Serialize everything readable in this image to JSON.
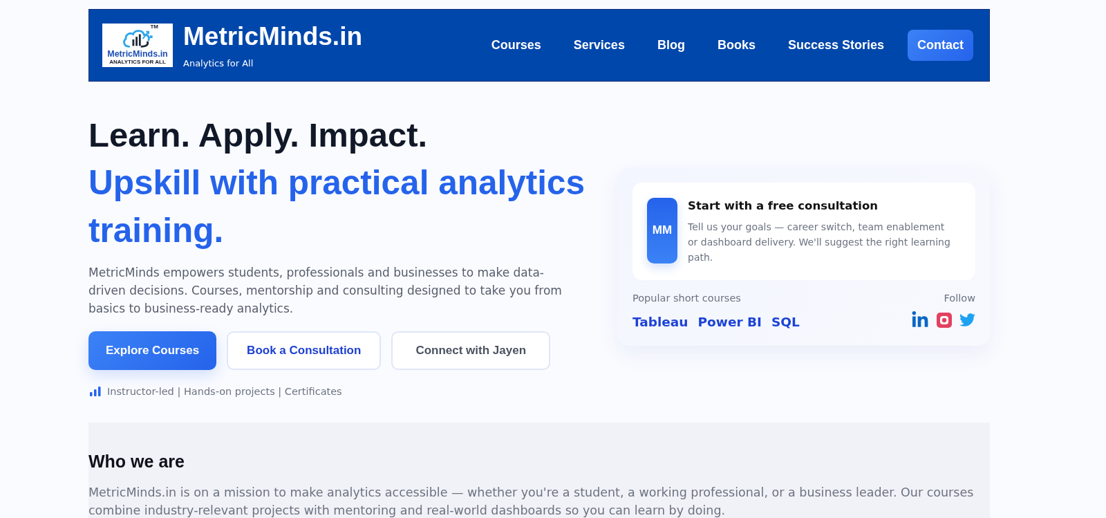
{
  "header": {
    "logo": {
      "mark": "TM",
      "wordmark": "MetricMinds.in",
      "tagline": "ANALYTICS FOR ALL"
    },
    "brand": "MetricMinds.in",
    "slogan": "Analytics for All"
  },
  "nav": [
    {
      "label": "Courses",
      "kind": "link"
    },
    {
      "label": "Services",
      "kind": "link"
    },
    {
      "label": "Blog",
      "kind": "link"
    },
    {
      "label": "Books",
      "kind": "link"
    },
    {
      "label": "Success Stories",
      "kind": "link"
    },
    {
      "label": "Contact",
      "kind": "button"
    }
  ],
  "hero": {
    "title": "Learn. Apply. Impact.",
    "subtitle": "Upskill with practical analytics training.",
    "intro": "MetricMinds empowers students, professionals and businesses to make data-driven decisions. Courses, mentorship and consulting designed to take you from basics to business-ready analytics.",
    "buttons": [
      {
        "label": "Explore Courses",
        "kind": "primary"
      },
      {
        "label": "Book a Consultation",
        "kind": "outline"
      },
      {
        "label": "Connect with Jayen",
        "kind": "ghost"
      }
    ],
    "features": "Instructor-led | Hands-on projects | Certificates"
  },
  "consult_card": {
    "badge": "MM",
    "title": "Start with a free consultation",
    "text": "Tell us your goals — career switch, team enablement or dashboard delivery. We'll suggest the right learning path.",
    "courses_label": "Popular short courses",
    "courses": [
      "Tableau",
      "Power BI",
      "SQL"
    ],
    "follow_label": "Follow",
    "socials": [
      {
        "kind": "linkedin"
      },
      {
        "kind": "instagram"
      },
      {
        "kind": "twitter"
      }
    ]
  },
  "about": {
    "title": "Who we are",
    "text": "MetricMinds.in is on a mission to make analytics accessible — whether you're a student, a working professional, or a business leader. Our courses combine industry-relevant projects with mentoring and real-world dashboards so you can learn by doing."
  }
}
